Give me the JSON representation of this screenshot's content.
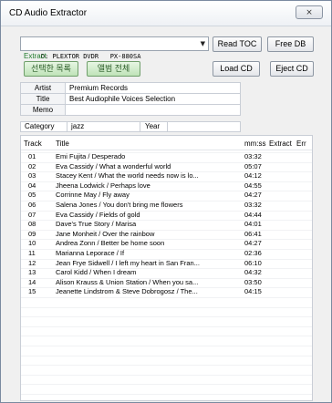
{
  "window": {
    "title": "CD Audio Extractor",
    "close_glyph": "⨯"
  },
  "drive": {
    "selected": "D: PLEXTOR DVDR   PX-880SA"
  },
  "buttons": {
    "read_toc": "Read TOC",
    "free_db": "Free DB",
    "selected_list": "선택한 목록",
    "whole_album": "앨범 전체",
    "load_cd": "Load CD",
    "eject_cd": "Eject CD"
  },
  "extract_label": "Extract",
  "album": {
    "artist_label": "Artist",
    "artist": "Premium Records",
    "title_label": "Title",
    "title": "Best Audiophile Voices Selection",
    "memo_label": "Memo",
    "memo": "",
    "category_label": "Category",
    "category": "jazz",
    "year_label": "Year",
    "year": ""
  },
  "tracks": {
    "columns": {
      "track": "Track",
      "title": "Title",
      "time": "mm:ss",
      "extract": "Extract",
      "err": "Err"
    },
    "rows": [
      {
        "no": "01",
        "title": "Emi Fujita / Desperado",
        "time": "03:32"
      },
      {
        "no": "02",
        "title": "Eva Cassidy / What a wonderful world",
        "time": "05:07"
      },
      {
        "no": "03",
        "title": "Stacey Kent / What the world needs now is lo...",
        "time": "04:12"
      },
      {
        "no": "04",
        "title": "Jheena Lodwick / Perhaps love",
        "time": "04:55"
      },
      {
        "no": "05",
        "title": "Corrinne May / Fly away",
        "time": "04:27"
      },
      {
        "no": "06",
        "title": "Salena Jones / You don't bring me flowers",
        "time": "03:32"
      },
      {
        "no": "07",
        "title": "Eva Cassidy / Fields of gold",
        "time": "04:44"
      },
      {
        "no": "08",
        "title": "Dave's True Story / Marisa",
        "time": "04:01"
      },
      {
        "no": "09",
        "title": "Jane Monheit / Over the rainbow",
        "time": "06:41"
      },
      {
        "no": "10",
        "title": "Andrea Zonn / Better be home soon",
        "time": "04:27"
      },
      {
        "no": "11",
        "title": "Marianna Leporace / If",
        "time": "02:36"
      },
      {
        "no": "12",
        "title": "Jean Frye Sidwell / I left my heart in San Fran...",
        "time": "06:10"
      },
      {
        "no": "13",
        "title": "Carol Kidd / When I dream",
        "time": "04:32"
      },
      {
        "no": "14",
        "title": "Alison Krauss & Union Station / When you sa...",
        "time": "03:50"
      },
      {
        "no": "15",
        "title": "Jeanette Lindstrom & Steve Dobrogosz / The...",
        "time": "04:15"
      }
    ]
  }
}
